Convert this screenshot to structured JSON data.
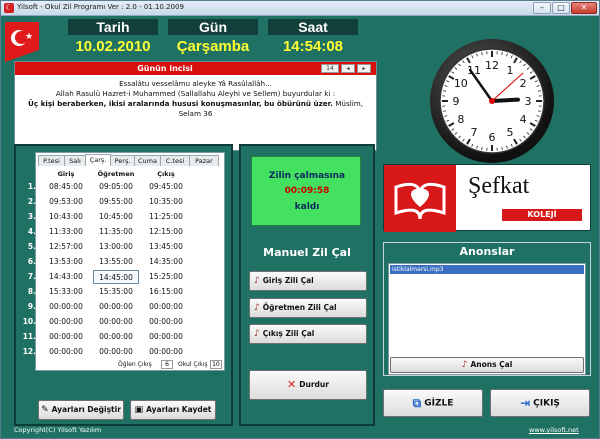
{
  "window": {
    "title": "Yilsoft - Okul Zil Programı  Ver : 2.0 - 01.10.2009",
    "minimize": "–",
    "maximize": "□",
    "close": "✕"
  },
  "header": {
    "date_label": "Tarih",
    "day_label": "Gün",
    "time_label": "Saat",
    "date_value": "10.02.2010",
    "day_value": "Çarşamba",
    "time_value": "14:54:08"
  },
  "quote": {
    "title": "Günün incisi",
    "nav_number": "14",
    "nav_prev": "◂",
    "nav_next": "▸",
    "line1": "Essalâtu vesselâmu aleyke Yâ Rasûlallâh...",
    "line2": "Allah Rasulü Hazret-i Muhammed (Sallallahu Aleyhi ve Sellem) buyurdular ki :",
    "line3_bold": "Üç kişi beraberken, ikisi aralarında hususi konuşmasınlar, bu öbürünü üzer.",
    "line3_source": " Müslim,",
    "line4": "Selam 36"
  },
  "clock": {
    "hour": 14,
    "minute": 54,
    "second": 8,
    "numerals": [
      "12",
      "1",
      "2",
      "3",
      "4",
      "5",
      "6",
      "7",
      "8",
      "9",
      "10",
      "11"
    ]
  },
  "schedule": {
    "tabs": [
      "P.tesi",
      "Salı",
      "Çarş.",
      "Perş.",
      "Cuma",
      "C.tesi",
      "Pazar"
    ],
    "active_tab": 2,
    "columns": [
      "Giriş",
      "Öğretmen",
      "Çıkış"
    ],
    "rows": [
      {
        "num": "1.",
        "giris": "08:45:00",
        "ogretmen": "09:05:00",
        "cikis": "09:45:00"
      },
      {
        "num": "2.",
        "giris": "09:53:00",
        "ogretmen": "09:55:00",
        "cikis": "10:35:00"
      },
      {
        "num": "3.",
        "giris": "10:43:00",
        "ogretmen": "10:45:00",
        "cikis": "11:25:00"
      },
      {
        "num": "4.",
        "giris": "11:33:00",
        "ogretmen": "11:35:00",
        "cikis": "12:15:00"
      },
      {
        "num": "5.",
        "giris": "12:57:00",
        "ogretmen": "13:00:00",
        "cikis": "13:45:00"
      },
      {
        "num": "6.",
        "giris": "13:53:00",
        "ogretmen": "13:55:00",
        "cikis": "14:35:00"
      },
      {
        "num": "7.",
        "giris": "14:43:00",
        "ogretmen": "14:45:00",
        "cikis": "15:25:00"
      },
      {
        "num": "8.",
        "giris": "15:33:00",
        "ogretmen": "15:35:00",
        "cikis": "16:15:00"
      },
      {
        "num": "9.",
        "giris": "00:00:00",
        "ogretmen": "00:00:00",
        "cikis": "00:00:00"
      },
      {
        "num": "10.",
        "giris": "00:00:00",
        "ogretmen": "00:00:00",
        "cikis": "00:00:00"
      },
      {
        "num": "11.",
        "giris": "00:00:00",
        "ogretmen": "00:00:00",
        "cikis": "00:00:00"
      },
      {
        "num": "12.",
        "giris": "00:00:00",
        "ogretmen": "00:00:00",
        "cikis": "00:00:00"
      }
    ],
    "selected_row": 6,
    "oglen_label": "Öğlen Çıkış",
    "oglen_value": "6",
    "okul_label": "Okul Çıkış",
    "okul_value": "10",
    "settings_button": "Ayarları Değiştir",
    "save_button": "Ayarları Kaydet"
  },
  "countdown": {
    "line1": "Zilin çalmasına",
    "remaining": "00:09:58",
    "line3": "kaldı",
    "bg_color": "#44e060"
  },
  "manual": {
    "title": "Manuel Zil Çal",
    "giris_button": "Giriş Zili Çal",
    "ogretmen_button": "Öğretmen Zili Çal",
    "cikis_button": "Çıkış Zili Çal",
    "stop_button": "Durdur"
  },
  "logo": {
    "name": "Şefkat",
    "sub": "KOLEJİ",
    "brand_color": "#d81818"
  },
  "announcements": {
    "title": "Anonslar",
    "items": [
      "istiklalmarsi.mp3"
    ],
    "play_button": "Anons Çal"
  },
  "actions": {
    "hide_button": "GİZLE",
    "exit_button": "ÇIKIŞ"
  },
  "status": {
    "copyright": "Copyright(C) Yilsoft Yazılım",
    "website": "www.yilsoft.net"
  },
  "colors": {
    "background": "#1f7163",
    "header_yellow": "#ffff33",
    "quote_red": "#d90f0f"
  }
}
